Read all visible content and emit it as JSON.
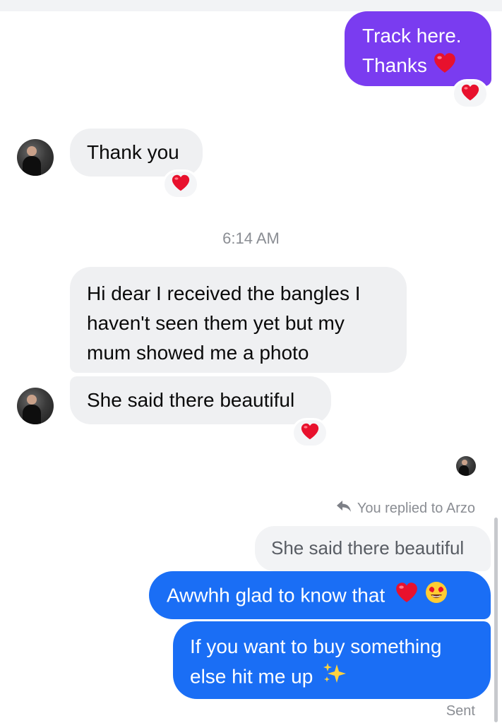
{
  "messages": {
    "m1": "Track here.",
    "m1b": "Thanks",
    "m2": "Thank you",
    "timestamp": "6:14 AM",
    "m3_line1": "Hi dear I received the bangles I",
    "m3_line2": "haven't seen them yet but my",
    "m3_line3": "mum showed me a photo",
    "m4": "She said there beautiful",
    "reply_meta": "You replied to Arzo",
    "quoted": "She said there beautiful",
    "m5": "Awwhh glad to know that",
    "m6_line1": "If you want to buy something",
    "m6_line2": "else hit me up",
    "status": "Sent"
  },
  "icons": {
    "heart": "red-heart-emoji",
    "heart_eyes": "smiling-face-with-heart-eyes-emoji",
    "sparkles": "sparkles-emoji",
    "reply": "reply-arrow-icon"
  },
  "colors": {
    "purple_bubble": "#7a3cf0",
    "blue_bubble": "#1a6ef5",
    "incoming_bubble": "#eff0f2",
    "heart": "#e8112d"
  }
}
